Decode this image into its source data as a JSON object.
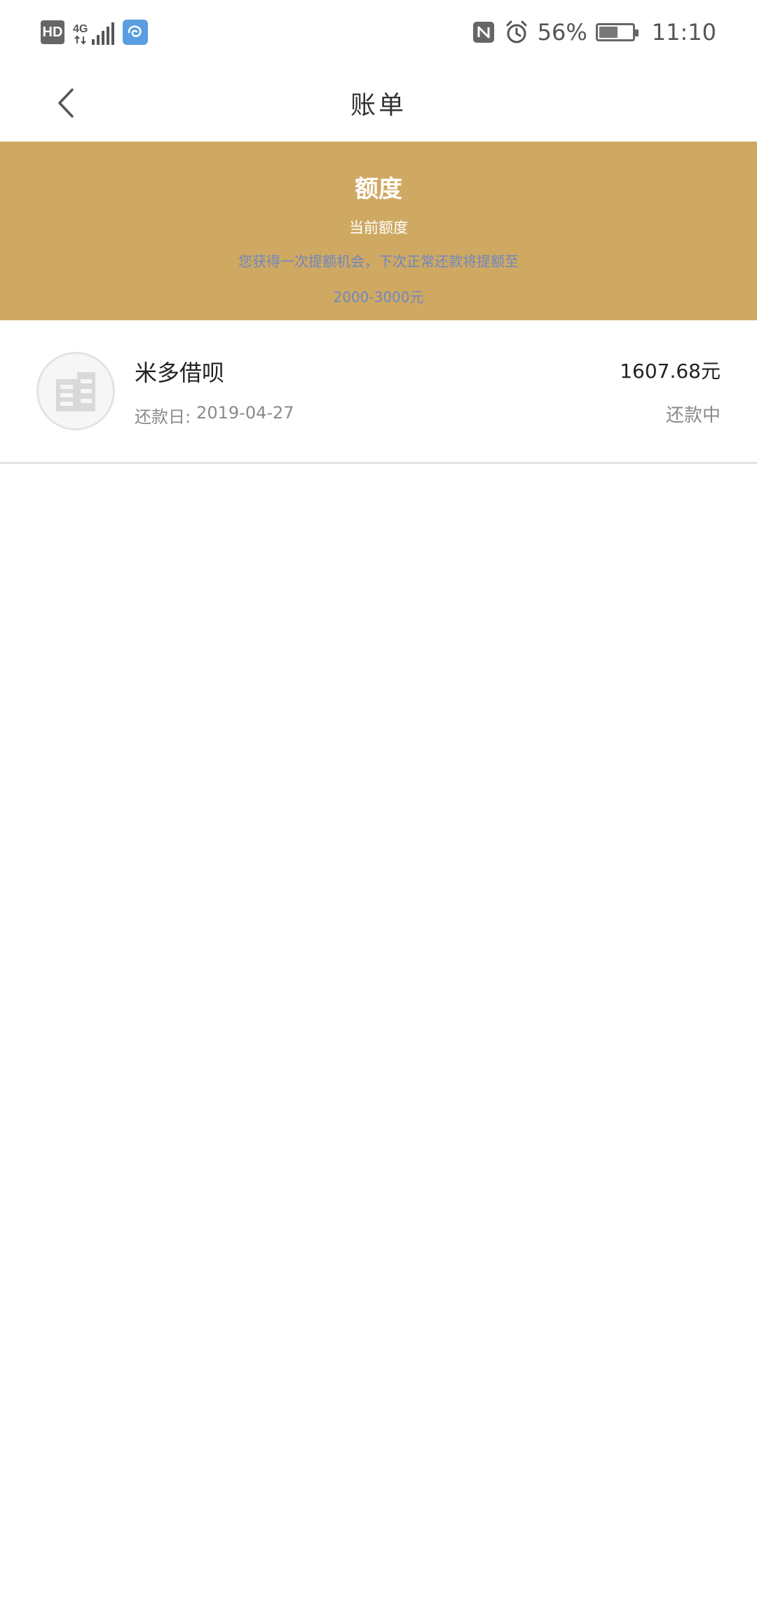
{
  "status_bar": {
    "hd_label": "HD",
    "network_type": "4G",
    "battery_percent": "56%",
    "battery_level": 0.56,
    "time": "11:10",
    "icons": [
      "hd-icon",
      "signal-icon",
      "app-notification-icon",
      "nfc-icon",
      "alarm-icon",
      "battery-icon"
    ]
  },
  "nav": {
    "title": "账单",
    "back_icon": "chevron-left-icon"
  },
  "quota": {
    "title": "额度",
    "subtitle": "当前额度",
    "tip": "您获得一次提额机会，下次正常还款将提额至",
    "range": "2000-3000元",
    "bg_color": "#cfa962",
    "tip_color": "#6f86c2"
  },
  "bills": [
    {
      "name": "米多借呗",
      "date_label": "还款日:",
      "date": "2019-04-27",
      "amount": "1607.68元",
      "status": "还款中",
      "avatar_icon": "building-icon"
    }
  ]
}
